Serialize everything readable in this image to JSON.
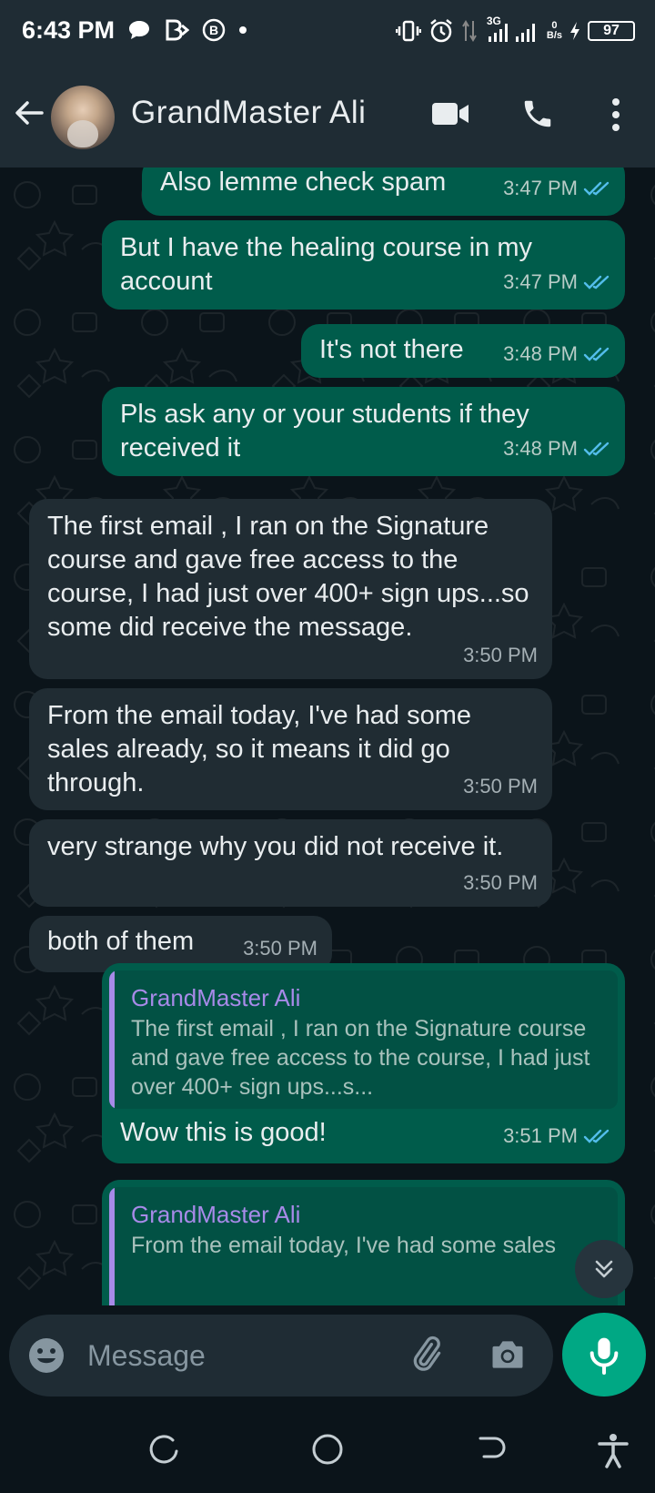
{
  "status_bar": {
    "time": "6:43 PM",
    "net_type": "3G",
    "speed_value": "0",
    "speed_unit": "B/s",
    "battery": "97"
  },
  "header": {
    "contact_name": "GrandMaster Ali",
    "icons": [
      "back-arrow-icon",
      "video-call-icon",
      "voice-call-icon",
      "more-options-icon"
    ]
  },
  "messages": [
    {
      "dir": "out",
      "text": "Also lemme check spam",
      "time": "3:47 PM",
      "status": "read"
    },
    {
      "dir": "out",
      "text": "But I have the healing course in my account",
      "time": "3:47 PM",
      "status": "read"
    },
    {
      "dir": "out",
      "text": "It's not there",
      "time": "3:48 PM",
      "status": "read"
    },
    {
      "dir": "out",
      "text": "Pls ask any or your students if they received it",
      "time": "3:48 PM",
      "status": "read"
    },
    {
      "dir": "in",
      "text": "The first email , I ran on the Signature course and gave free access to the course, I had just over 400+ sign ups...so some did receive the message.",
      "time": "3:50 PM"
    },
    {
      "dir": "in",
      "text": "From the email today, I've had some sales already, so it means it did go through.",
      "time": "3:50 PM"
    },
    {
      "dir": "in",
      "text": "very strange why you did not receive it.",
      "time": "3:50 PM"
    },
    {
      "dir": "in",
      "text": "both of them",
      "time": "3:50 PM"
    },
    {
      "dir": "out",
      "quote_name": "GrandMaster Ali",
      "quote_text": "The first email , I ran on the Signature course and gave free access to the course, I had just over 400+ sign ups...s...",
      "text": "Wow this is good!",
      "time": "3:51 PM",
      "status": "read"
    },
    {
      "dir": "out",
      "quote_name": "GrandMaster Ali",
      "quote_text": "From the email today, I've had some sales"
    }
  ],
  "composer": {
    "placeholder": "Message",
    "icons": [
      "emoji-icon",
      "attach-icon",
      "camera-icon",
      "mic-icon"
    ]
  },
  "colors": {
    "outgoing_bubble": "#005c4b",
    "incoming_bubble": "#202c33",
    "accent": "#00a884",
    "read_ticks": "#53bdeb",
    "quote_name": "#a78ae8"
  }
}
